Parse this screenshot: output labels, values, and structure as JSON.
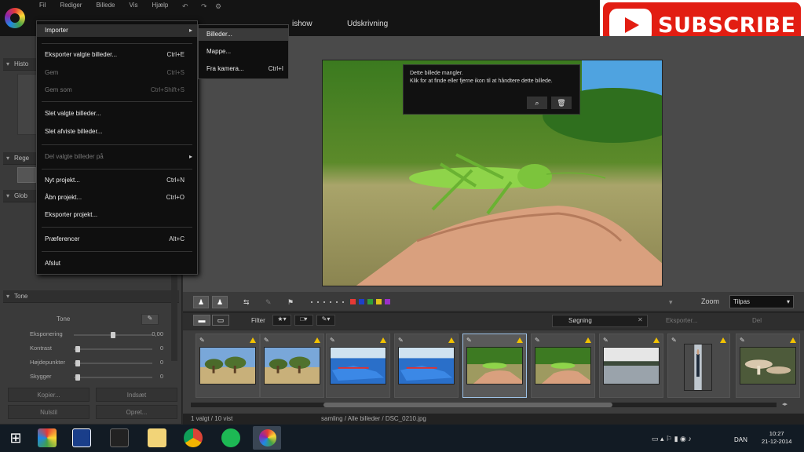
{
  "menubar": [
    "Fil",
    "Rediger",
    "Billede",
    "Vis",
    "Hjælp"
  ],
  "top_tabs": [
    "ishow",
    "Udskrivning"
  ],
  "subscribe": {
    "label": "SUBSCRIBE"
  },
  "file_menu": {
    "items": [
      {
        "label": "Importer",
        "shortcut": "",
        "disabled": false,
        "submenu": true
      },
      {
        "label": "Eksporter valgte billeder...",
        "shortcut": "Ctrl+E",
        "disabled": false
      },
      {
        "label": "Gem",
        "shortcut": "Ctrl+S",
        "disabled": true
      },
      {
        "label": "Gem som",
        "shortcut": "Ctrl+Shift+S",
        "disabled": true
      },
      {
        "label": "Slet valgte billeder...",
        "shortcut": "",
        "disabled": false
      },
      {
        "label": "Slet afviste billeder...",
        "shortcut": "",
        "disabled": false
      },
      {
        "label": "Del valgte billeder på",
        "shortcut": "",
        "disabled": true,
        "submenu": true
      },
      {
        "label": "Nyt projekt...",
        "shortcut": "Ctrl+N",
        "disabled": false
      },
      {
        "label": "Åbn projekt...",
        "shortcut": "Ctrl+O",
        "disabled": false
      },
      {
        "label": "Eksporter projekt...",
        "shortcut": "",
        "disabled": false
      },
      {
        "label": "Præferencer",
        "shortcut": "Alt+C",
        "disabled": false
      },
      {
        "label": "Afslut",
        "shortcut": "",
        "disabled": false
      }
    ]
  },
  "import_submenu": [
    {
      "label": "Billeder...",
      "shortcut": ""
    },
    {
      "label": "Mappe...",
      "shortcut": ""
    },
    {
      "label": "Fra kamera...",
      "shortcut": "Ctrl+I"
    }
  ],
  "left_panel": {
    "sections": [
      "Histo",
      "Rege",
      "Glob",
      "Tone"
    ],
    "tone_label": "Tone",
    "sliders": [
      {
        "label": "Eksponering",
        "value": "0,00",
        "fraction": 0.5
      },
      {
        "label": "Kontrast",
        "value": "0",
        "fraction": 0.05
      },
      {
        "label": "Højdepunkter",
        "value": "0",
        "fraction": 0.05
      },
      {
        "label": "Skygger",
        "value": "0",
        "fraction": 0.05
      }
    ],
    "buttons": [
      "Kopier...",
      "Indsæt",
      "Nulstil",
      "Opret..."
    ]
  },
  "tooltip": {
    "title": "Dette billede mangler.",
    "body": "Klik for at finde eller fjerne ikon til at håndtere dette billede."
  },
  "swatches": [
    "#e53935",
    "#1e40c8",
    "#2e9e3a",
    "#e0c21a",
    "#9b30c8"
  ],
  "zoom": {
    "label": "Zoom",
    "value": "Tilpas"
  },
  "filter": {
    "label": "Filter",
    "search_value": "Søgning",
    "export_label": "Eksporter...",
    "share_label": "Del"
  },
  "thumbnails": [
    {
      "kind": "trees",
      "selected": false
    },
    {
      "kind": "trees",
      "selected": false
    },
    {
      "kind": "boats",
      "selected": false
    },
    {
      "kind": "boats",
      "selected": false
    },
    {
      "kind": "grasshopper",
      "selected": true
    },
    {
      "kind": "grasshopper",
      "selected": false
    },
    {
      "kind": "lake",
      "selected": false
    },
    {
      "kind": "person",
      "selected": false
    },
    {
      "kind": "mushrooms",
      "selected": false
    }
  ],
  "status": {
    "left": "1 valgt / 10 vist",
    "path": "samling / Alle billeder / DSC_0210.jpg"
  },
  "taskbar": {
    "lang": "DAN",
    "time": "10:27",
    "date": "21-12-2014"
  }
}
